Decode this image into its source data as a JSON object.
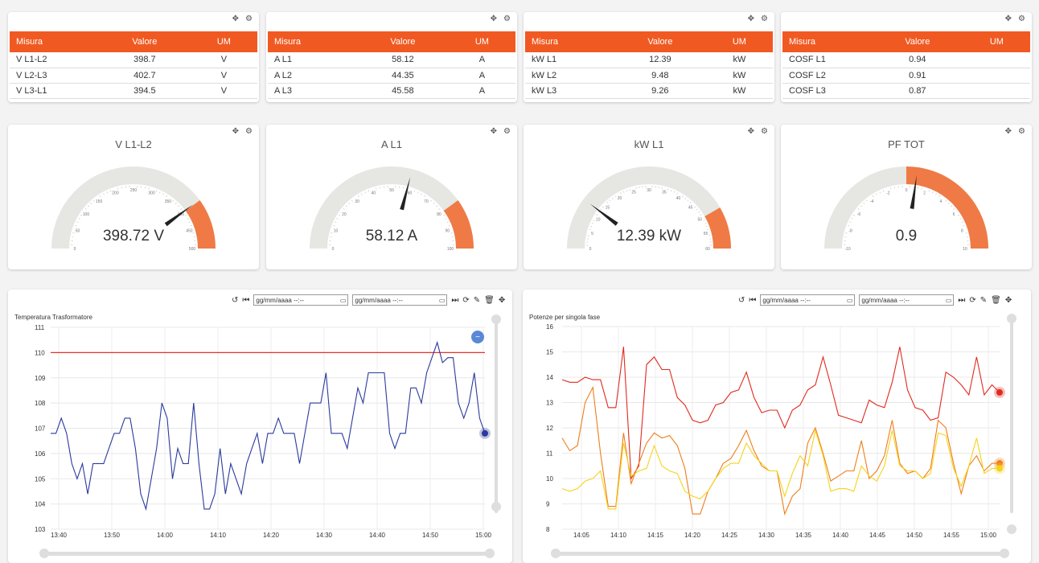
{
  "colors": {
    "accent": "#f05a22",
    "gauge_fill": "#f07a45",
    "gauge_track": "#e6e6e3",
    "needle": "#222222",
    "volt_line": "#2b3a9c",
    "limit_line": "#e8312a",
    "phase1": "#e02a1f",
    "phase2": "#f07d1a",
    "phase3": "#f5d31a"
  },
  "tools": {
    "move_icon": "✥",
    "gear_icon": "⚙"
  },
  "tables": [
    {
      "headers": [
        "Misura",
        "Valore",
        "UM"
      ],
      "rows": [
        [
          "V L1-L2",
          "398.7",
          "V"
        ],
        [
          "V L2-L3",
          "402.7",
          "V"
        ],
        [
          "V L3-L1",
          "394.5",
          "V"
        ]
      ]
    },
    {
      "headers": [
        "Misura",
        "Valore",
        "UM"
      ],
      "rows": [
        [
          "A L1",
          "58.12",
          "A"
        ],
        [
          "A L2",
          "44.35",
          "A"
        ],
        [
          "A L3",
          "45.58",
          "A"
        ]
      ]
    },
    {
      "headers": [
        "Misura",
        "Valore",
        "UM"
      ],
      "rows": [
        [
          "kW L1",
          "12.39",
          "kW"
        ],
        [
          "kW L2",
          "9.48",
          "kW"
        ],
        [
          "kW L3",
          "9.26",
          "kW"
        ]
      ]
    },
    {
      "headers": [
        "Misura",
        "Valore",
        "UM"
      ],
      "rows": [
        [
          "COSF L1",
          "0.94",
          ""
        ],
        [
          "COSF L2",
          "0.91",
          ""
        ],
        [
          "COSF L3",
          "0.87",
          ""
        ]
      ]
    }
  ],
  "gauges": [
    {
      "title": "V L1-L2",
      "value_text": "398.72 V",
      "value": 398.72,
      "min": 0,
      "max": 500,
      "band_from": 400,
      "ticks": [
        "0",
        "50",
        "100",
        "150",
        "200",
        "250",
        "300",
        "350",
        "400",
        "450",
        "500"
      ]
    },
    {
      "title": "A L1",
      "value_text": "58.12 A",
      "value": 58.12,
      "min": 0,
      "max": 100,
      "band_from": 80,
      "ticks": [
        "0",
        "10",
        "20",
        "30",
        "40",
        "50",
        "60",
        "70",
        "80",
        "90",
        "100"
      ]
    },
    {
      "title": "kW L1",
      "value_text": "12.39 kW",
      "value": 12.39,
      "min": 0,
      "max": 60,
      "band_from": 50,
      "ticks": [
        "0",
        "5",
        "10",
        "15",
        "20",
        "25",
        "30",
        "35",
        "40",
        "45",
        "50",
        "55",
        "60"
      ]
    },
    {
      "title": "PF TOT",
      "value_text": "0.9",
      "value": 0.9,
      "min": -10,
      "max": 10,
      "band_from": 0,
      "ticks": [
        "-10",
        "-8",
        "-6",
        "-4",
        "-2",
        "0",
        "2",
        "4",
        "6",
        "8",
        "10"
      ]
    }
  ],
  "toolbar": {
    "undo_icon": "↺",
    "first_icon": "⏮",
    "date_placeholder": "gg/mm/aaaa --:--",
    "calendar_icon": "▭",
    "last_icon": "⏭",
    "refresh_icon": "⟳",
    "edit_icon": "✎",
    "delete_icon": "🗑",
    "move_icon": "✥"
  },
  "chart_data": [
    {
      "type": "line",
      "title": "Temperatura Trasformatore",
      "ylim": [
        103,
        111
      ],
      "yticks": [
        "103",
        "104",
        "105",
        "106",
        "107",
        "108",
        "109",
        "110",
        "111"
      ],
      "xticks": [
        "13:40",
        "13:50",
        "14:00",
        "14:10",
        "14:20",
        "14:30",
        "14:40",
        "14:50",
        "15:00"
      ],
      "limit_line": 110,
      "series": [
        {
          "values": [
            106.8,
            106.8,
            107.4,
            106.8,
            105.6,
            105.0,
            105.6,
            104.4,
            105.6,
            105.6,
            105.6,
            106.2,
            106.8,
            106.8,
            107.4,
            107.4,
            106.2,
            104.4,
            103.8,
            105.0,
            106.2,
            108.0,
            107.4,
            105.0,
            106.2,
            105.6,
            105.6,
            108.0,
            105.6,
            103.8,
            103.8,
            104.4,
            106.2,
            104.4,
            105.6,
            105.0,
            104.4,
            105.6,
            106.2,
            106.8,
            105.6,
            106.8,
            106.8,
            107.4,
            106.8,
            106.8,
            106.8,
            105.6,
            106.8,
            108.0,
            108.0,
            108.0,
            109.2,
            106.8,
            106.8,
            106.8,
            106.2,
            107.4,
            108.6,
            108.0,
            109.2,
            109.2,
            109.2,
            109.2,
            106.8,
            106.2,
            106.8,
            106.8,
            108.6,
            108.6,
            108.0,
            109.2,
            109.8,
            110.4,
            109.6,
            109.8,
            109.8,
            108.0,
            107.4,
            108.0,
            109.2,
            107.4,
            106.8
          ]
        }
      ]
    },
    {
      "type": "line",
      "title": "Potenze per singola fase",
      "ylim": [
        8,
        16
      ],
      "yticks": [
        "8",
        "9",
        "10",
        "11",
        "12",
        "13",
        "14",
        "15",
        "16"
      ],
      "xticks": [
        "14:05",
        "14:10",
        "14:15",
        "14:20",
        "14:25",
        "14:30",
        "14:35",
        "14:40",
        "14:45",
        "14:50",
        "14:55",
        "15:00"
      ],
      "series": [
        {
          "values": [
            13.9,
            13.8,
            13.8,
            14.0,
            13.9,
            13.9,
            12.8,
            12.8,
            15.2,
            10.0,
            10.5,
            14.5,
            14.8,
            14.3,
            14.3,
            13.2,
            12.9,
            12.3,
            12.2,
            12.3,
            12.9,
            13.0,
            13.4,
            13.5,
            14.2,
            13.2,
            12.6,
            12.7,
            12.7,
            12.0,
            12.7,
            12.9,
            13.5,
            13.7,
            14.8,
            13.7,
            12.5,
            12.4,
            12.3,
            12.2,
            13.1,
            12.9,
            12.8,
            13.8,
            15.2,
            13.5,
            12.8,
            12.7,
            12.3,
            12.4,
            14.2,
            14.0,
            13.7,
            13.3,
            14.8,
            13.3,
            13.7,
            13.4
          ]
        },
        {
          "values": [
            11.6,
            11.1,
            11.3,
            13.0,
            13.6,
            11.0,
            8.9,
            8.9,
            11.8,
            9.8,
            10.6,
            11.4,
            11.8,
            11.6,
            11.7,
            11.3,
            10.4,
            8.6,
            8.6,
            9.5,
            10.0,
            10.6,
            10.8,
            11.3,
            11.9,
            11.1,
            10.5,
            10.3,
            10.3,
            8.6,
            9.3,
            9.6,
            11.4,
            12.0,
            11.0,
            9.9,
            10.1,
            10.3,
            10.3,
            11.5,
            10.0,
            10.3,
            10.9,
            12.3,
            10.6,
            10.2,
            10.3,
            10.0,
            10.4,
            12.3,
            12.0,
            10.6,
            9.4,
            10.5,
            10.9,
            10.3,
            10.6,
            10.6
          ]
        },
        {
          "values": [
            9.6,
            9.5,
            9.6,
            9.9,
            10.0,
            10.3,
            8.8,
            8.8,
            11.4,
            10.1,
            10.3,
            10.4,
            11.3,
            10.5,
            10.3,
            10.2,
            9.5,
            9.3,
            9.2,
            9.5,
            10.0,
            10.4,
            10.6,
            10.6,
            11.4,
            10.9,
            10.6,
            10.3,
            10.3,
            9.3,
            10.2,
            10.9,
            10.5,
            11.9,
            10.9,
            9.5,
            9.6,
            9.6,
            9.5,
            10.5,
            10.1,
            9.9,
            10.5,
            11.9,
            10.5,
            10.3,
            10.3,
            10.0,
            10.2,
            11.8,
            11.7,
            10.4,
            9.7,
            10.5,
            11.6,
            10.2,
            10.4,
            10.4
          ]
        }
      ]
    }
  ]
}
